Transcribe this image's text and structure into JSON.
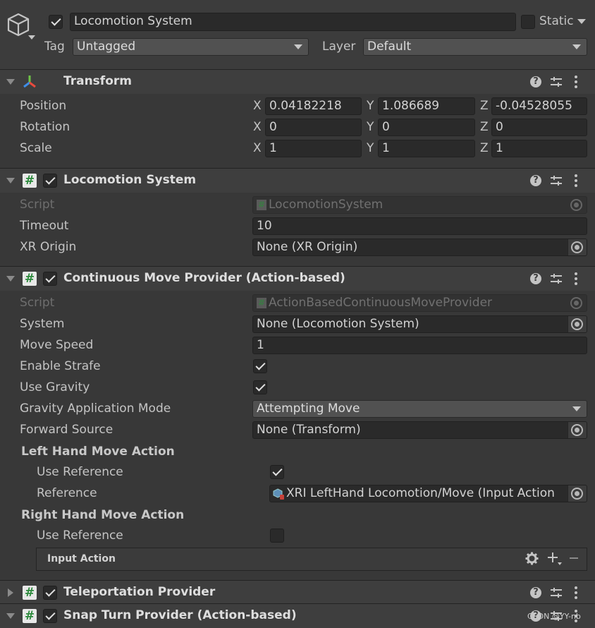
{
  "gameobject": {
    "name": "Locomotion System",
    "static_label": "Static",
    "tag_label": "Tag",
    "tag_value": "Untagged",
    "layer_label": "Layer",
    "layer_value": "Default"
  },
  "transform": {
    "title": "Transform",
    "position_label": "Position",
    "rotation_label": "Rotation",
    "scale_label": "Scale",
    "axis_x": "X",
    "axis_y": "Y",
    "axis_z": "Z",
    "position": {
      "x": "0.04182218",
      "y": "1.086689",
      "z": "-0.04528055"
    },
    "rotation": {
      "x": "0",
      "y": "0",
      "z": "0"
    },
    "scale": {
      "x": "1",
      "y": "1",
      "z": "1"
    }
  },
  "locomotion_system": {
    "title": "Locomotion System",
    "script_label": "Script",
    "script_value": "LocomotionSystem",
    "timeout_label": "Timeout",
    "timeout_value": "10",
    "xr_origin_label": "XR Origin",
    "xr_origin_value": "None (XR Origin)"
  },
  "continuous_move": {
    "title": "Continuous Move Provider (Action-based)",
    "script_label": "Script",
    "script_value": "ActionBasedContinuousMoveProvider",
    "system_label": "System",
    "system_value": "None (Locomotion System)",
    "move_speed_label": "Move Speed",
    "move_speed_value": "1",
    "enable_strafe_label": "Enable Strafe",
    "use_gravity_label": "Use Gravity",
    "gravity_mode_label": "Gravity Application Mode",
    "gravity_mode_value": "Attempting Move",
    "forward_source_label": "Forward Source",
    "forward_source_value": "None (Transform)",
    "left_hand_header": "Left Hand Move Action",
    "left_use_reference_label": "Use Reference",
    "left_reference_label": "Reference",
    "left_reference_value": "XRI LeftHand Locomotion/Move (Input Action",
    "right_hand_header": "Right Hand Move Action",
    "right_use_reference_label": "Use Reference",
    "input_action_label": "Input Action"
  },
  "teleportation": {
    "title": "Teleportation Provider"
  },
  "snap_turn": {
    "title": "Snap Turn Provider (Action-based)"
  },
  "watermark": "CSDN @YY-nb"
}
